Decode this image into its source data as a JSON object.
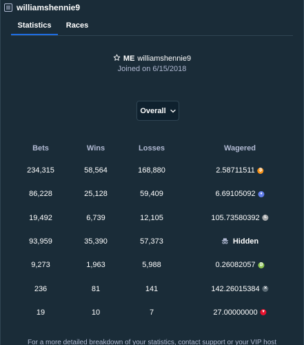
{
  "header": {
    "title": "williamshennie9",
    "icon": "stats-list-icon"
  },
  "tabs": [
    {
      "label": "Statistics",
      "active": true
    },
    {
      "label": "Races",
      "active": false
    }
  ],
  "profile": {
    "badge": "ME",
    "username": "williamshennie9",
    "joined": "Joined on 6/15/2018",
    "star_icon": "star-outline-icon"
  },
  "filter": {
    "selected": "Overall",
    "icon": "chevron-down-icon"
  },
  "table": {
    "headers": [
      "Bets",
      "Wins",
      "Losses",
      "Wagered"
    ],
    "rows": [
      {
        "bets": "234,315",
        "wins": "58,564",
        "losses": "168,880",
        "wagered": "2.58711511",
        "currency_icon": "bitcoin-icon",
        "color": "#f7931a"
      },
      {
        "bets": "86,228",
        "wins": "25,128",
        "losses": "59,409",
        "wagered": "6.69105092",
        "currency_icon": "ethereum-icon",
        "color": "#627eea"
      },
      {
        "bets": "19,492",
        "wins": "6,739",
        "losses": "12,105",
        "wagered": "105.73580392",
        "currency_icon": "litecoin-icon",
        "color": "#a6a9aa"
      },
      {
        "bets": "93,959",
        "wins": "35,390",
        "losses": "57,373",
        "wagered": "Hidden",
        "currency_icon": "incognito-icon",
        "color": "#b1bad3"
      },
      {
        "bets": "9,273",
        "wins": "1,963",
        "losses": "5,988",
        "wagered": "0.26082057",
        "currency_icon": "bitcoin-cash-icon",
        "color": "#8dc351"
      },
      {
        "bets": "236",
        "wins": "81",
        "losses": "141",
        "wagered": "142.26015384",
        "currency_icon": "ripple-icon",
        "color": "#5a6a74"
      },
      {
        "bets": "19",
        "wins": "10",
        "losses": "7",
        "wagered": "27.00000000",
        "currency_icon": "tron-icon",
        "color": "#e8112d"
      }
    ]
  },
  "footer": {
    "text": "For a more detailed breakdown of your statistics, contact support or your VIP host"
  }
}
